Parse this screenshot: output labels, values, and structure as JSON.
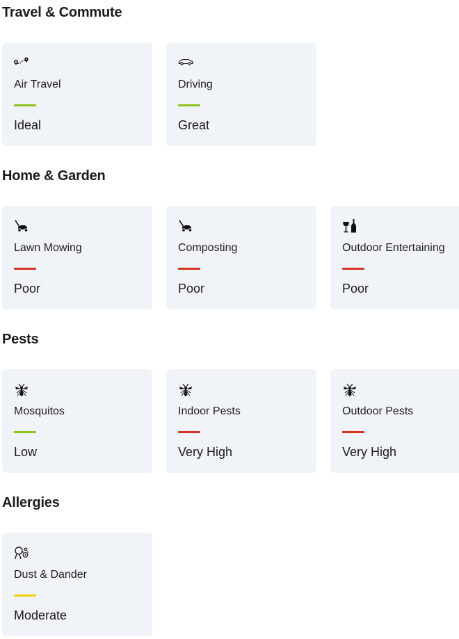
{
  "colors": {
    "good": "#8fc21d",
    "poor": "#d43222",
    "moderate": "#f2d100",
    "card_bg": "#f0f3f7"
  },
  "sections": [
    {
      "title": "Travel & Commute",
      "cards": [
        {
          "icon": "air-travel-route-icon",
          "label": "Air Travel",
          "status": "Ideal",
          "rating": "good"
        },
        {
          "icon": "car-icon",
          "label": "Driving",
          "status": "Great",
          "rating": "good"
        }
      ]
    },
    {
      "title": "Home & Garden",
      "cards": [
        {
          "icon": "lawn-mower-icon",
          "label": "Lawn Mowing",
          "status": "Poor",
          "rating": "poor"
        },
        {
          "icon": "lawn-mower-icon",
          "label": "Composting",
          "status": "Poor",
          "rating": "poor"
        },
        {
          "icon": "wine-bottle-glass-icon",
          "label": "Outdoor Entertaining",
          "status": "Poor",
          "rating": "poor"
        }
      ]
    },
    {
      "title": "Pests",
      "cards": [
        {
          "icon": "mosquito-icon",
          "label": "Mosquitos",
          "status": "Low",
          "rating": "good"
        },
        {
          "icon": "mosquito-icon",
          "label": "Indoor Pests",
          "status": "Very High",
          "rating": "poor"
        },
        {
          "icon": "mosquito-icon",
          "label": "Outdoor Pests",
          "status": "Very High",
          "rating": "poor"
        }
      ]
    },
    {
      "title": "Allergies",
      "cards": [
        {
          "icon": "dust-dander-icon",
          "label": "Dust & Dander",
          "status": "Moderate",
          "rating": "moderate"
        }
      ]
    }
  ]
}
